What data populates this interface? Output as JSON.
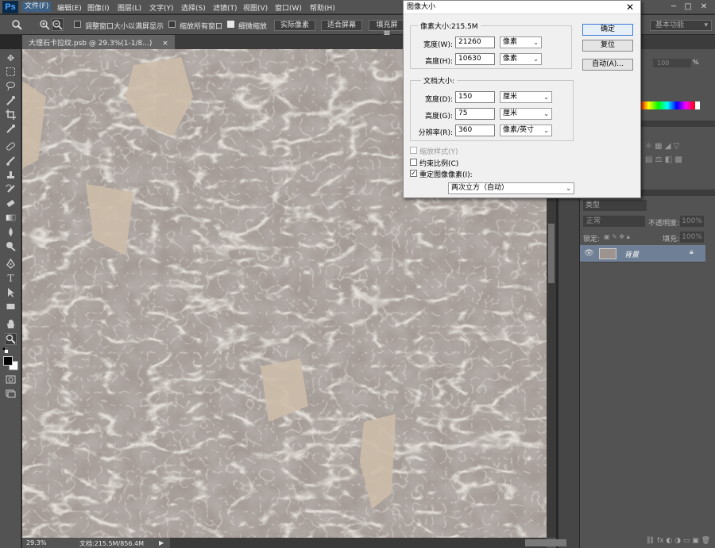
{
  "app": {
    "logo": "Ps"
  },
  "menu": [
    "文件(F)",
    "编辑(E)",
    "图像(I)",
    "图层(L)",
    "文字(Y)",
    "选择(S)",
    "滤镜(T)",
    "视图(V)",
    "窗口(W)",
    "帮助(H)"
  ],
  "window_controls": {
    "min": "─",
    "max": "□",
    "close": "✕"
  },
  "options": {
    "fit_window": "调整窗口大小以满屏显示",
    "zoom_all": "缩放所有窗口",
    "scrubby": "细微缩放",
    "actual_pixels": "实际像素",
    "fit_screen": "适合屏幕",
    "fill_screen": "填充屏幕",
    "workspace": "基本功能"
  },
  "document": {
    "tab": "大理石卡拉纹.psb @ 29.3%(1-1/8...)",
    "tab_close": "×"
  },
  "status": {
    "zoom": "29.3%",
    "doc": "文档:215.5M/856.4M"
  },
  "dialog": {
    "title": "图像大小",
    "pixel_dims_label": "像素大小:215.5M",
    "width_label": "宽度(W):",
    "width_value": "21260",
    "width_unit": "像素",
    "height_label": "高度(H):",
    "height_value": "10630",
    "height_unit": "像素",
    "doc_size_label": "文档大小:",
    "dwidth_label": "宽度(D):",
    "dwidth_value": "150",
    "dwidth_unit": "厘米",
    "dheight_label": "高度(G):",
    "dheight_value": "75",
    "dheight_unit": "厘米",
    "res_label": "分辨率(R):",
    "res_value": "360",
    "res_unit": "像素/英寸",
    "scale_styles": "缩放样式(Y)",
    "constrain": "约束比例(C)",
    "resample": "重定图像像素(I):",
    "resample_method": "两次立方（自动）",
    "ok": "确定",
    "reset": "复位",
    "auto": "自动(A)..."
  },
  "layers": {
    "kind": "类型",
    "blend": "正常",
    "opacity_label": "不透明度:",
    "opacity_value": "100%",
    "lock_label": "锁定:",
    "fill_label": "填充:",
    "fill_value": "100%",
    "layer_name": "背景"
  },
  "color_panel": {
    "value": "100",
    "unit": "%"
  }
}
